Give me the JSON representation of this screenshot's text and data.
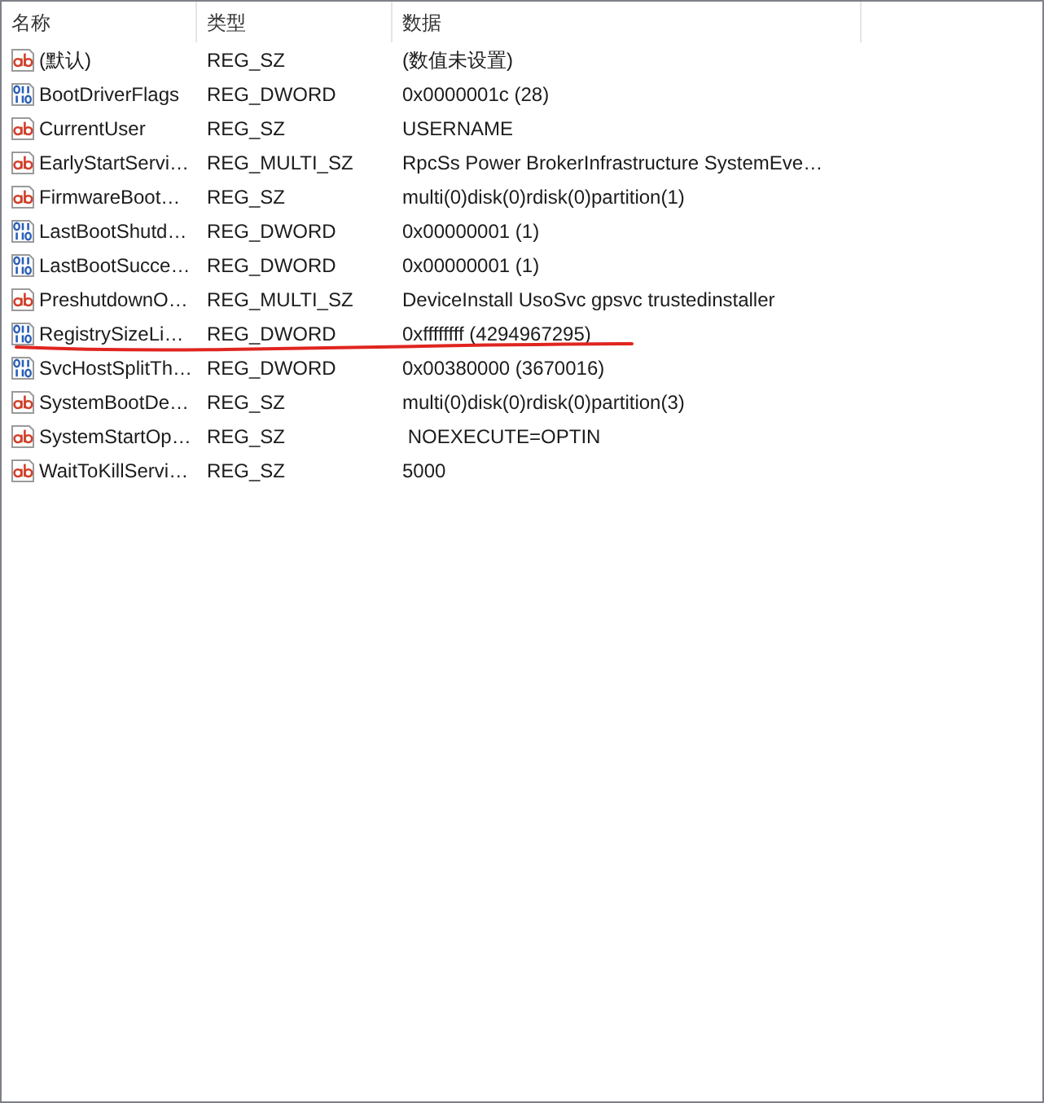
{
  "columns": [
    {
      "label": "名称"
    },
    {
      "label": "类型"
    },
    {
      "label": "数据"
    }
  ],
  "rows": [
    {
      "kind": "string",
      "name": "(默认)",
      "type": "REG_SZ",
      "data": "(数值未设置)",
      "underlined": false
    },
    {
      "kind": "binary",
      "name": "BootDriverFlags",
      "type": "REG_DWORD",
      "data": "0x0000001c (28)",
      "underlined": false
    },
    {
      "kind": "string",
      "name": "CurrentUser",
      "type": "REG_SZ",
      "data": "USERNAME",
      "underlined": false
    },
    {
      "kind": "string",
      "name": "EarlyStartServi…",
      "type": "REG_MULTI_SZ",
      "data": "RpcSs Power BrokerInfrastructure SystemEve…",
      "underlined": false
    },
    {
      "kind": "string",
      "name": "FirmwareBoot…",
      "type": "REG_SZ",
      "data": "multi(0)disk(0)rdisk(0)partition(1)",
      "underlined": false
    },
    {
      "kind": "binary",
      "name": "LastBootShutd…",
      "type": "REG_DWORD",
      "data": "0x00000001 (1)",
      "underlined": false
    },
    {
      "kind": "binary",
      "name": "LastBootSucce…",
      "type": "REG_DWORD",
      "data": "0x00000001 (1)",
      "underlined": false
    },
    {
      "kind": "string",
      "name": "PreshutdownO…",
      "type": "REG_MULTI_SZ",
      "data": "DeviceInstall UsoSvc gpsvc trustedinstaller",
      "underlined": false
    },
    {
      "kind": "binary",
      "name": "RegistrySizeLi…",
      "type": "REG_DWORD",
      "data": "0xffffffff (4294967295)",
      "underlined": true
    },
    {
      "kind": "binary",
      "name": "SvcHostSplitTh…",
      "type": "REG_DWORD",
      "data": "0x00380000 (3670016)",
      "underlined": false
    },
    {
      "kind": "string",
      "name": "SystemBootDe…",
      "type": "REG_SZ",
      "data": "multi(0)disk(0)rdisk(0)partition(3)",
      "underlined": false
    },
    {
      "kind": "string",
      "name": "SystemStartOp…",
      "type": "REG_SZ",
      "data": " NOEXECUTE=OPTIN",
      "underlined": false
    },
    {
      "kind": "string",
      "name": "WaitToKillServi…",
      "type": "REG_SZ",
      "data": "5000",
      "underlined": false
    }
  ]
}
